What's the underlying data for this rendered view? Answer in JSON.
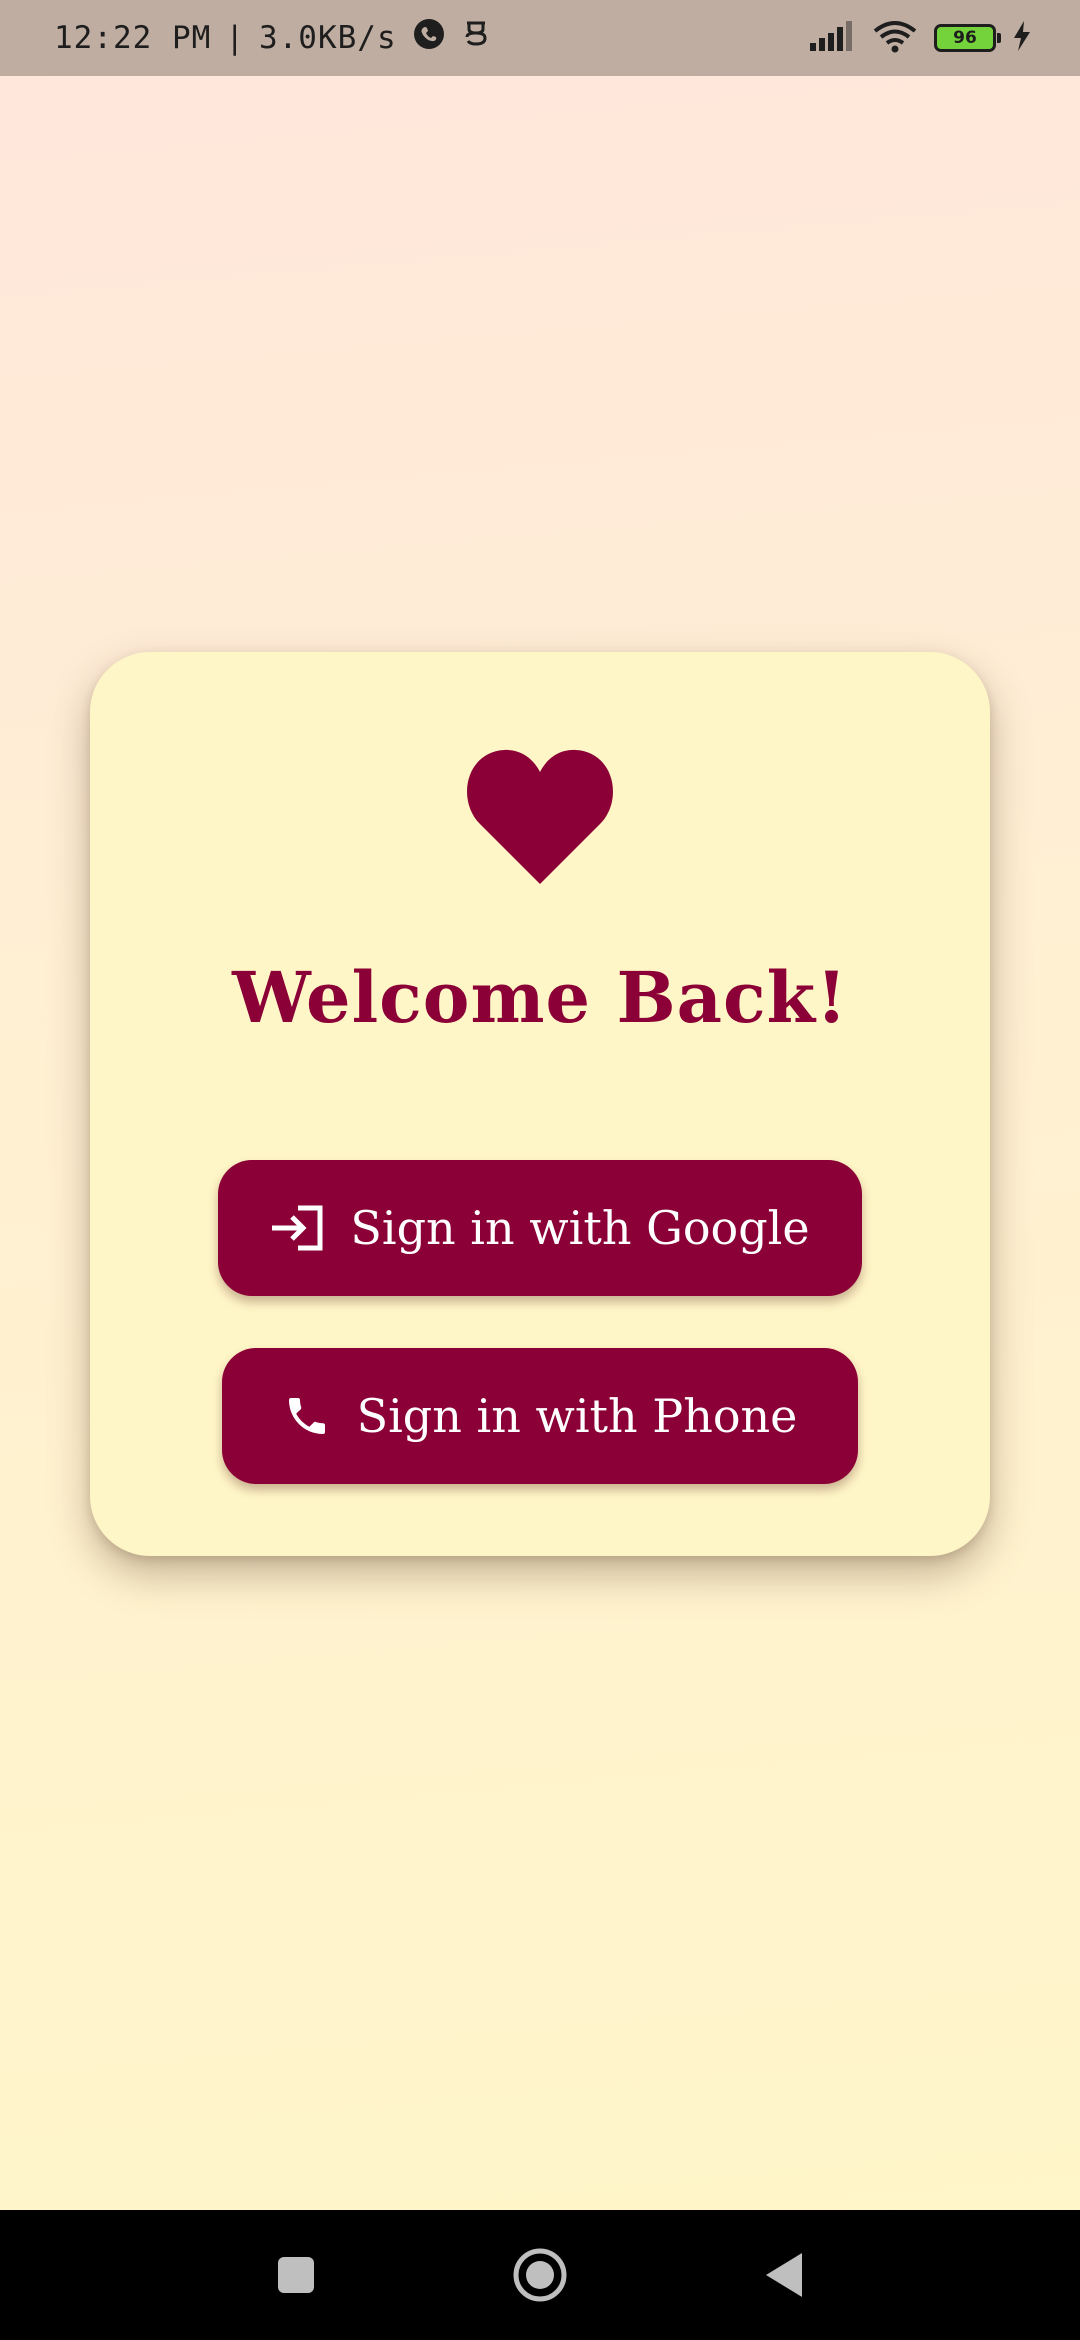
{
  "status_bar": {
    "time": "12:22 PM",
    "separator": "|",
    "net_speed": "3.0KB/s",
    "battery_level": "96",
    "icons": [
      "whatsapp-icon",
      "notification-app-icon",
      "signal-icon",
      "wifi-icon",
      "battery-icon",
      "charging-icon"
    ]
  },
  "card": {
    "icon": "heart-icon",
    "title": "Welcome Back!",
    "buttons": [
      {
        "label": "Sign in with Google",
        "icon": "login-icon"
      },
      {
        "label": "Sign in with Phone",
        "icon": "phone-icon"
      }
    ]
  },
  "nav_bar": {
    "icons": [
      "recents-icon",
      "home-icon",
      "back-icon"
    ]
  },
  "colors": {
    "accent": "#8B0036",
    "card_bg": "#FFF6C7",
    "status_bar_bg": "#BFADA1",
    "battery_fill": "#74D23A"
  }
}
